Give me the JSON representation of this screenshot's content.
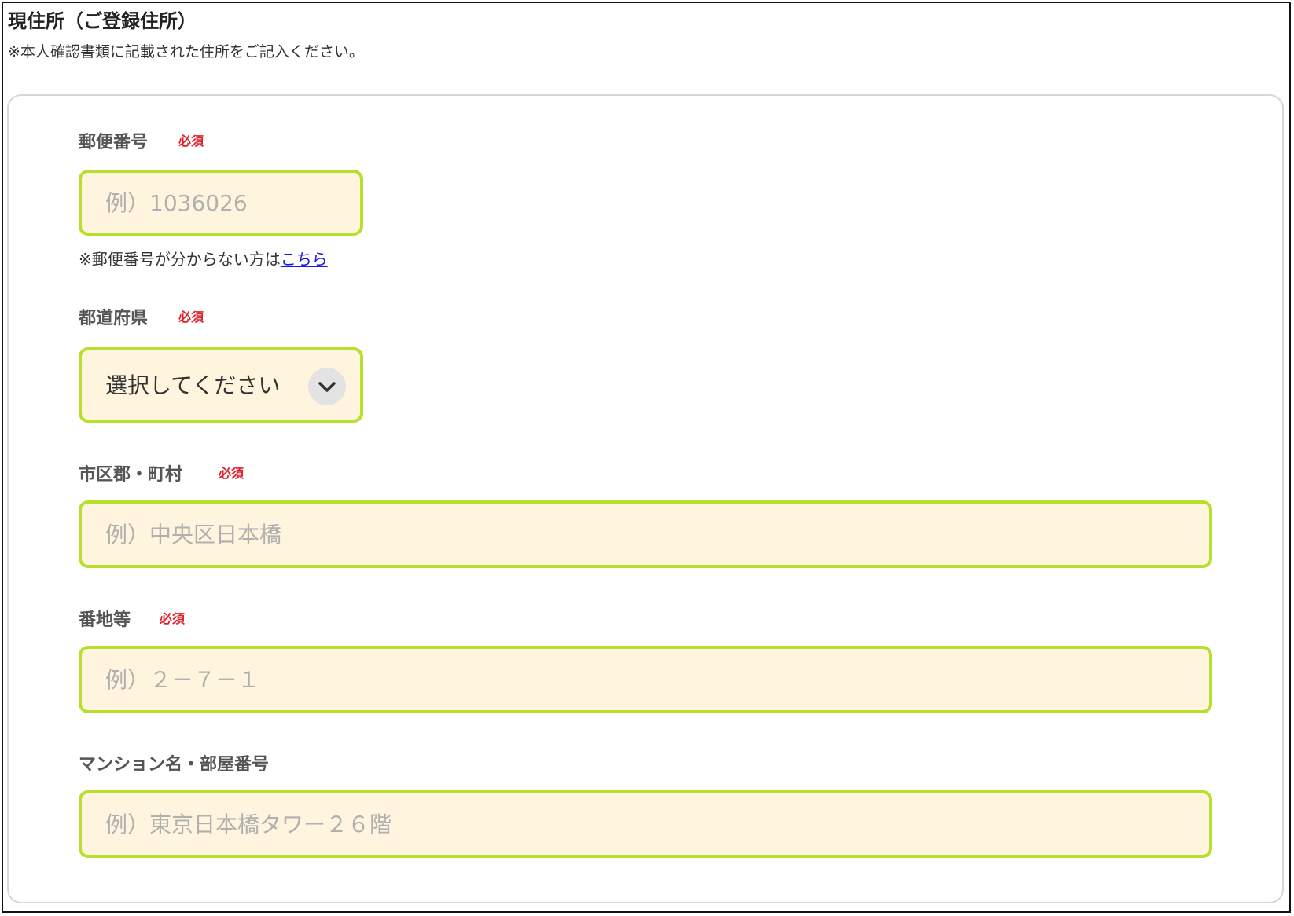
{
  "section": {
    "title": "現住所（ご登録住所）",
    "note": "※本人確認書類に記載された住所をご記入ください。"
  },
  "required_label": "必須",
  "postal_code": {
    "label": "郵便番号",
    "required": true,
    "value": "",
    "placeholder": "例）1036026",
    "help_prefix": "※郵便番号が分からない方は",
    "help_link": "こちら"
  },
  "prefecture": {
    "label": "都道府県",
    "required": true,
    "selected": "選択してください",
    "icon": "chevron-down-icon"
  },
  "city": {
    "label": "市区郡・町村",
    "required": true,
    "value": "",
    "placeholder": "例）中央区日本橋"
  },
  "street": {
    "label": "番地等",
    "required": true,
    "value": "",
    "placeholder": "例）２－７－１"
  },
  "building": {
    "label": "マンション名・部屋番号",
    "required": false,
    "value": "",
    "placeholder": "例）東京日本橋タワー２６階"
  },
  "colors": {
    "input_border": "#b7e02c",
    "input_background": "#fff4dd",
    "required": "#e0202a",
    "link": "#1a1ae6"
  }
}
